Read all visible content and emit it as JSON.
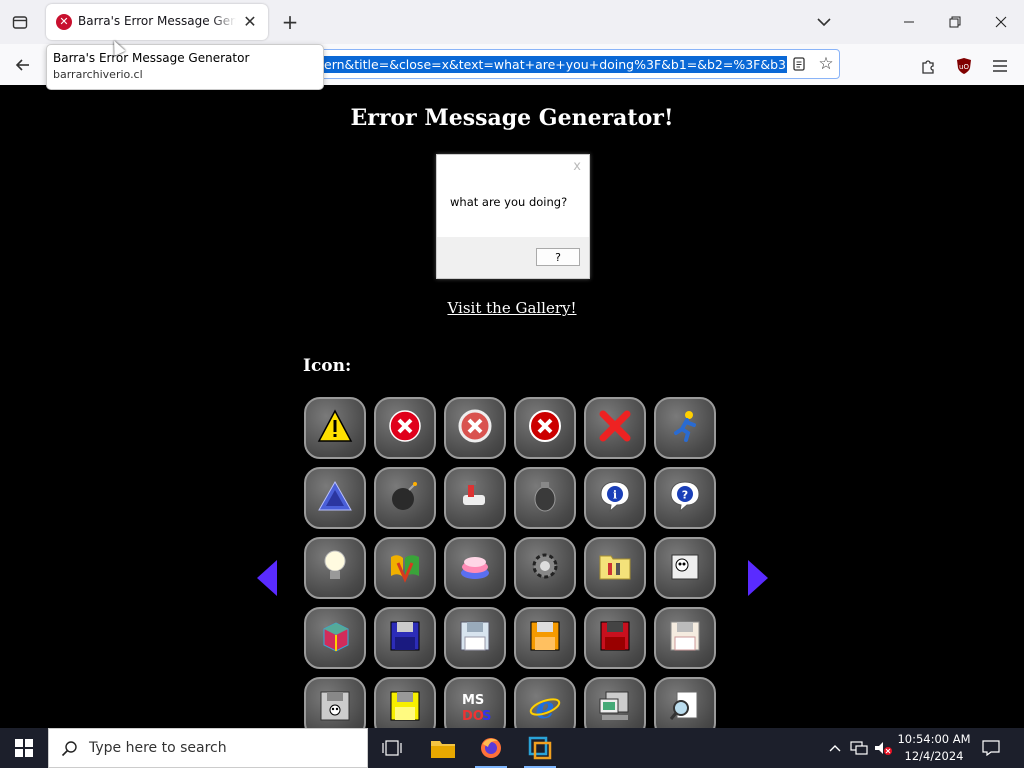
{
  "browser": {
    "tab_title": "Barra's Error Message Generator",
    "url_highlighted": "ern&title=&close=x&text=what+are+you+doing%3F&b1=&b2=%3F&b3=",
    "tooltip_title": "Barra's Error Message Generator",
    "tooltip_domain": "barrarchiverio.cl"
  },
  "page": {
    "heading": "Error Message Generator!",
    "dialog_close": "x",
    "dialog_text": "what are you doing?",
    "dialog_button": "?",
    "gallery_link": "Visit the Gallery!",
    "icon_label": "Icon:"
  },
  "icons": [
    [
      "warning-triangle-icon",
      "error-red-x-icon",
      "error-grey-x-icon",
      "error-dark-x-icon",
      "big-red-x-icon",
      "aim-runner-icon"
    ],
    [
      "pyramid-icon",
      "bomb-icon",
      "hand-tools-icon",
      "grenade-icon",
      "info-bubble-icon",
      "question-bubble-icon"
    ],
    [
      "lightbulb-icon",
      "windows-me-logo-icon",
      "cake-icon",
      "gear-mechanism-icon",
      "folder-tools-icon",
      "cow-icon"
    ],
    [
      "cube-icon",
      "floppy-blue-icon",
      "floppy-white-icon",
      "floppy-orange-icon",
      "floppy-red-icon",
      "floppy-beige-icon"
    ],
    [
      "floppy-skull-icon",
      "floppy-yellow-icon",
      "msdos-icon",
      "internet-explorer-icon",
      "computer-icon",
      "magnifier-document-icon"
    ]
  ],
  "taskbar": {
    "search_placeholder": "Type here to search",
    "time": "10:54:00 AM",
    "date": "12/4/2024"
  }
}
